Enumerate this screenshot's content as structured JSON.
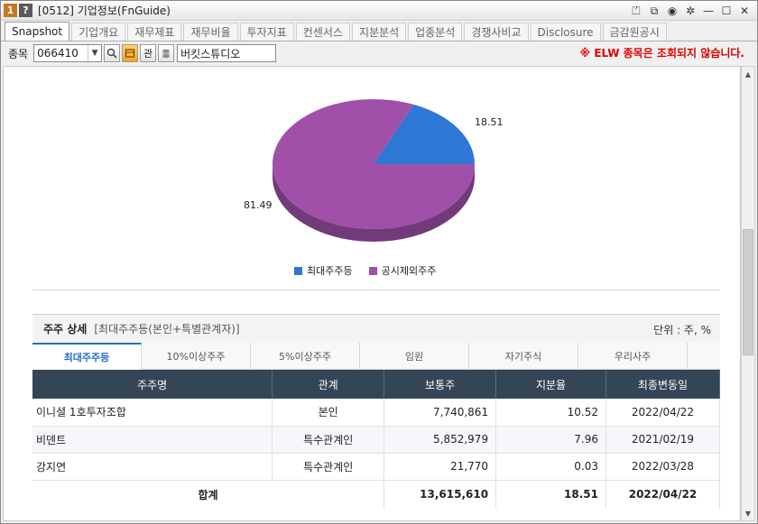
{
  "window": {
    "badge_1": "1",
    "badge_q": "?",
    "title": "[0512] 기업정보(FnGuide)",
    "controls": [
      "⏍",
      "⧉",
      "◉",
      "✲",
      "—",
      "☐",
      "✕"
    ]
  },
  "tabs": [
    {
      "label": "Snapshot",
      "active": true
    },
    {
      "label": "기업개요",
      "active": false
    },
    {
      "label": "재무제표",
      "active": false
    },
    {
      "label": "재무비율",
      "active": false
    },
    {
      "label": "투자지표",
      "active": false
    },
    {
      "label": "컨센서스",
      "active": false
    },
    {
      "label": "지분분석",
      "active": false
    },
    {
      "label": "업종분석",
      "active": false
    },
    {
      "label": "경쟁사비교",
      "active": false
    },
    {
      "label": "Disclosure",
      "active": false
    },
    {
      "label": "금감원공시",
      "active": false
    }
  ],
  "toolbar": {
    "code_label": "종목",
    "code_value": "066410",
    "search_icon": "magnifier",
    "btn_gwan": "관",
    "company_name": "버킷스튜디오",
    "notice": "※ ELW 종목은 조회되지 않습니다."
  },
  "chart_data": {
    "type": "pie",
    "slices": [
      {
        "label": "최대주주등",
        "value": 18.51,
        "color": "#2e77d4"
      },
      {
        "label": "공시제외주주",
        "value": 81.49,
        "color": "#a050a8"
      }
    ],
    "legend_position": "bottom",
    "value_labels": [
      "18.51",
      "81.49"
    ]
  },
  "section": {
    "title": "주주 상세",
    "subtitle": "[최대주주등(본인+특별관계자)]",
    "unit": "단위 : 주, %"
  },
  "subtabs": [
    {
      "label": "최대주주등",
      "active": true
    },
    {
      "label": "10%이상주주",
      "active": false
    },
    {
      "label": "5%이상주주",
      "active": false
    },
    {
      "label": "임원",
      "active": false
    },
    {
      "label": "자기주식",
      "active": false
    },
    {
      "label": "우리사주",
      "active": false
    }
  ],
  "table": {
    "headers": [
      "주주명",
      "관계",
      "보통주",
      "지분율",
      "최종변동일"
    ],
    "rows": [
      {
        "name": "이니셜 1호투자조합",
        "relation": "본인",
        "shares": "7,740,861",
        "ratio": "10.52",
        "date": "2022/04/22"
      },
      {
        "name": "비덴트",
        "relation": "특수관계인",
        "shares": "5,852,979",
        "ratio": "7.96",
        "date": "2021/02/19"
      },
      {
        "name": "강지연",
        "relation": "특수관계인",
        "shares": "21,770",
        "ratio": "0.03",
        "date": "2022/03/28"
      }
    ],
    "total": {
      "label": "합계",
      "shares": "13,615,610",
      "ratio": "18.51",
      "date": "2022/04/22"
    }
  }
}
